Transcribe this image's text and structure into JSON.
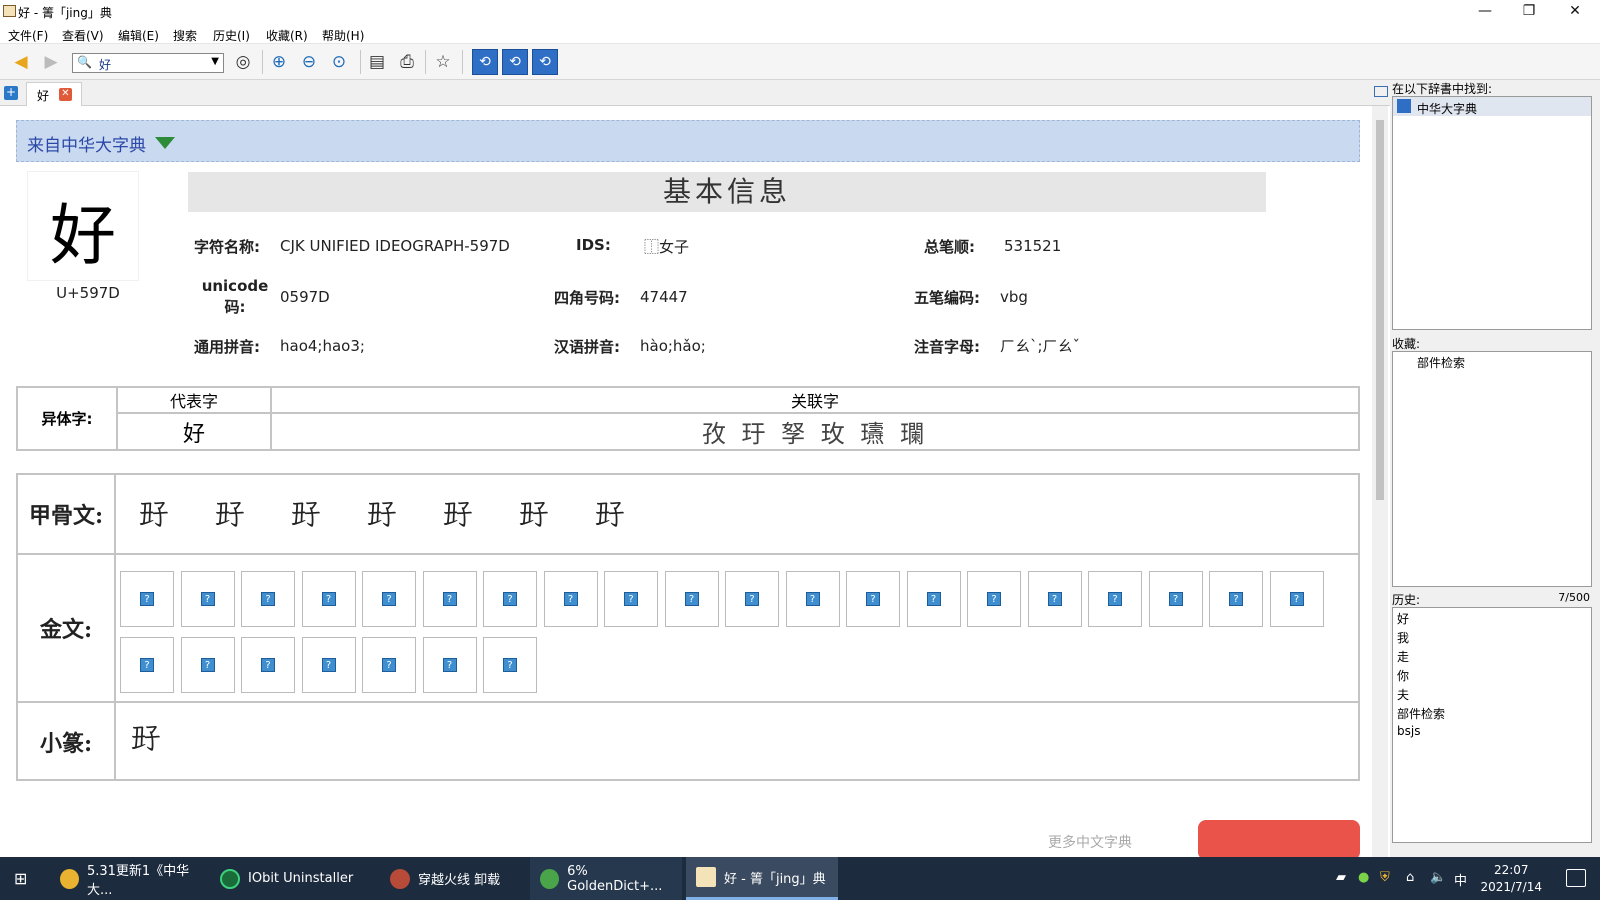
{
  "window": {
    "title": "好 - 箐「jing」典",
    "minimize": "—",
    "maximize": "❐",
    "close": "✕"
  },
  "menu": [
    "文件(F)",
    "查看(V)",
    "编辑(E)",
    "搜索",
    "历史(I)",
    "收藏(R)",
    "帮助(H)"
  ],
  "search": {
    "value": "好"
  },
  "tab": {
    "label": "好"
  },
  "content": {
    "source_banner": "来自中华大字典",
    "big_char": "好",
    "codepoint": "U+597D",
    "section_title": "基本信息",
    "fields": {
      "char_name_label": "字符名称:",
      "char_name": "CJK UNIFIED IDEOGRAPH-597D",
      "ids_label": "IDS:",
      "ids": "⿰女子",
      "strokes_label": "总笔顺:",
      "strokes": "531521",
      "unicode_label": "unicode码:",
      "unicode": "0597D",
      "sijiao_label": "四角号码:",
      "sijiao": "47447",
      "wubi_label": "五笔编码:",
      "wubi": "vbg",
      "tongyong_label": "通用拼音:",
      "tongyong": "hao4;hao3;",
      "hanyu_label": "汉语拼音:",
      "hanyu": "hào;hǎo;",
      "zhuyin_label": "注音字母:",
      "zhuyin": "ㄏㄠˋ;ㄏㄠˇ"
    },
    "variants": {
      "label": "异体字:",
      "col_rep": "代表字",
      "col_rel": "关联字",
      "rep": "好",
      "rel": "孜 玗 孥 玫 瓙 瓓"
    },
    "scripts": {
      "oracle_label": "甲骨文:",
      "oracle_glyphs": [
        "𡥆",
        "𡥆",
        "𡥆",
        "𡥆",
        "𡥆",
        "𡥆",
        "𡥆"
      ],
      "bronze_label": "金文:",
      "bronze_count_row1": 20,
      "bronze_count_row2": 7,
      "bronze_placeholder": "?",
      "seal_label": "小篆:",
      "seal_glyph": "𡥆"
    },
    "footer_hint": "更多中文字典"
  },
  "right_panel": {
    "found_title": "在以下辞書中找到:",
    "found_items": [
      "中华大字典"
    ],
    "fav_title": "收藏:",
    "fav_items": [
      "部件检索"
    ],
    "history_title": "历史:",
    "history_count": "7/500",
    "history_items": [
      "好",
      "我",
      "走",
      "你",
      "夫",
      "部件检索",
      "bsjs"
    ]
  },
  "taskbar": {
    "tasks": [
      "5.31更新1《中华大...",
      "IObit Uninstaller",
      "穿越火线 卸载",
      "6% GoldenDict+...",
      "好 - 箐「jing」典"
    ],
    "ime": "中",
    "time": "22:07",
    "date": "2021/7/14"
  }
}
